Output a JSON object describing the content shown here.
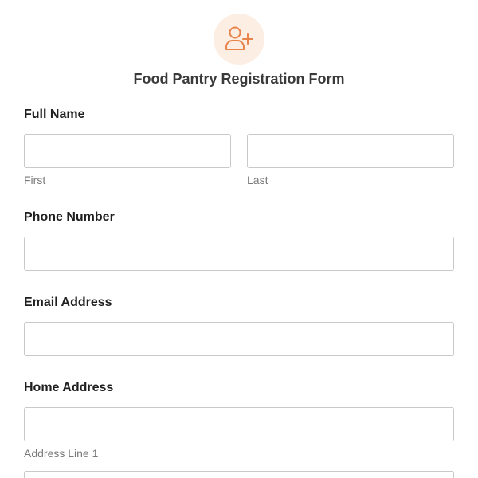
{
  "header": {
    "icon": "user-plus-icon",
    "icon_color": "#e8834a",
    "icon_bg": "#fdeee3",
    "title": "Food Pantry Registration Form"
  },
  "fields": {
    "full_name": {
      "label": "Full Name",
      "first": {
        "value": "",
        "placeholder": "",
        "sub_label": "First"
      },
      "last": {
        "value": "",
        "placeholder": "",
        "sub_label": "Last"
      }
    },
    "phone": {
      "label": "Phone Number",
      "value": "",
      "placeholder": ""
    },
    "email": {
      "label": "Email Address",
      "value": "",
      "placeholder": ""
    },
    "home_address": {
      "label": "Home Address",
      "line1": {
        "value": "",
        "placeholder": "",
        "sub_label": "Address Line 1"
      },
      "line2": {
        "value": "",
        "placeholder": ""
      }
    }
  }
}
